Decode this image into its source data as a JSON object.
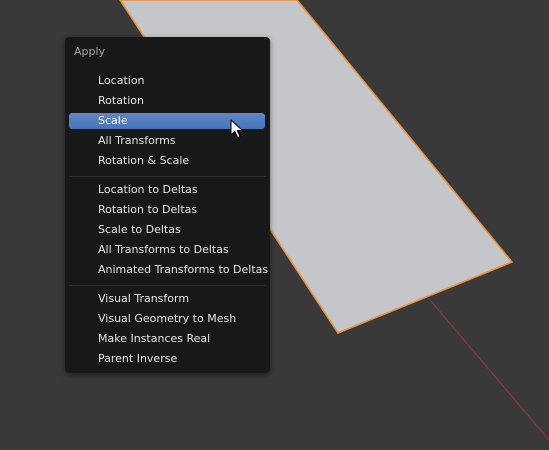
{
  "viewport": {
    "background_color": "#393939",
    "mesh_face_color": "#c4c6c9",
    "selection_outline_color": "#e6913a",
    "axis_line_color": "#8a3a3f"
  },
  "menu": {
    "title": "Apply",
    "highlight_color": "#5680c2",
    "groups": [
      {
        "items": [
          {
            "label": "Location"
          },
          {
            "label": "Rotation"
          },
          {
            "label": "Scale",
            "active": true
          },
          {
            "label": "All Transforms"
          },
          {
            "label": "Rotation & Scale"
          }
        ]
      },
      {
        "items": [
          {
            "label": "Location to Deltas"
          },
          {
            "label": "Rotation to Deltas"
          },
          {
            "label": "Scale to Deltas"
          },
          {
            "label": "All Transforms to Deltas"
          },
          {
            "label": "Animated Transforms to Deltas"
          }
        ]
      },
      {
        "items": [
          {
            "label": "Visual Transform"
          },
          {
            "label": "Visual Geometry to Mesh"
          },
          {
            "label": "Make Instances Real"
          },
          {
            "label": "Parent Inverse"
          }
        ]
      }
    ]
  },
  "cursor": {
    "icon": "arrow-pointer-icon"
  }
}
